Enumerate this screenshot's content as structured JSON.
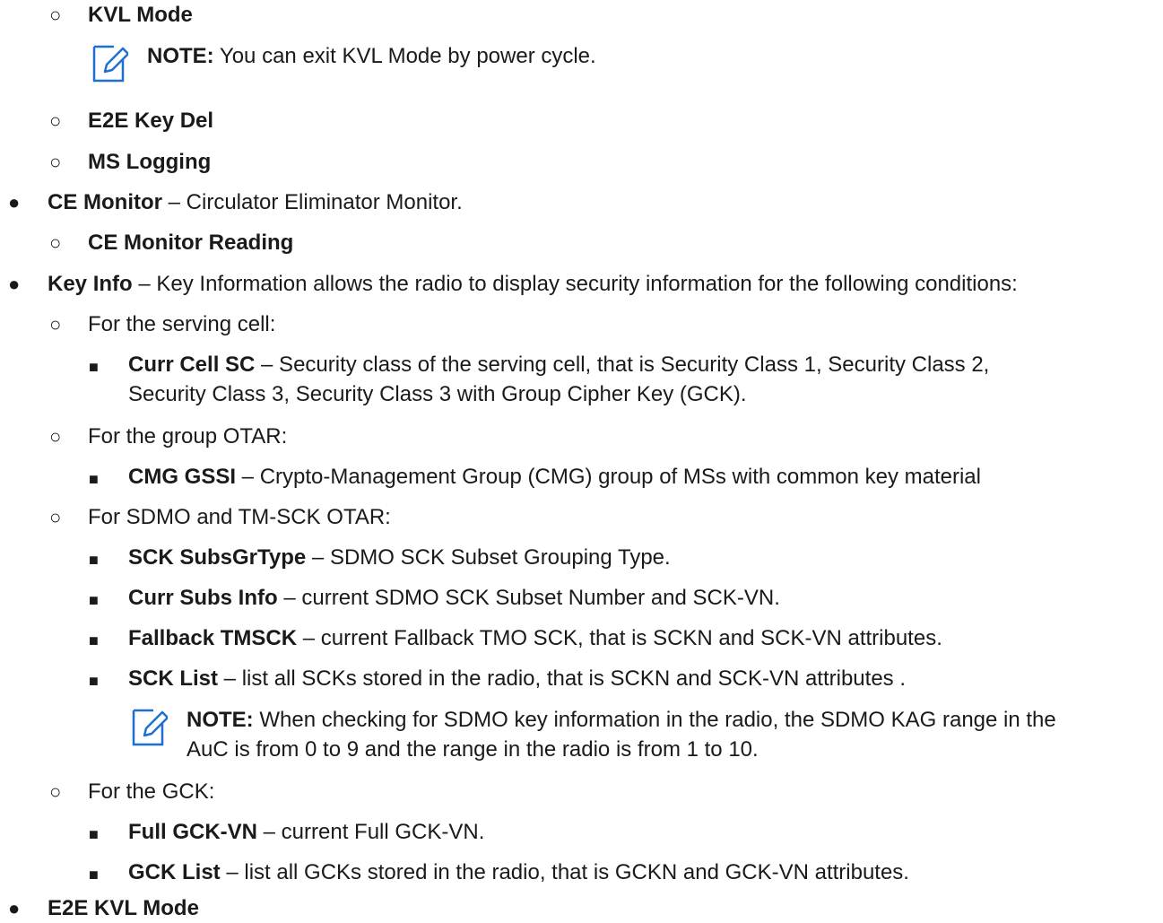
{
  "items": [
    {
      "level": 2,
      "bold": "KVL Mode",
      "text": ""
    },
    {
      "note": true,
      "label": "NOTE:",
      "text": " You can exit KVL Mode by power cycle."
    },
    {
      "level": 2,
      "bold": "E2E Key Del",
      "text": ""
    },
    {
      "level": 2,
      "bold": "MS Logging",
      "text": ""
    },
    {
      "level": 1,
      "bold": "CE Monitor",
      "text": " – Circulator Eliminator Monitor."
    },
    {
      "level": 2,
      "bold": "CE Monitor Reading",
      "text": ""
    },
    {
      "level": 1,
      "bold": "Key Info",
      "text": " – Key Information allows the radio to display security information for the following conditions:"
    },
    {
      "level": 2,
      "bold": "",
      "text": "For the serving cell:"
    },
    {
      "level": 3,
      "bold": "Curr Cell SC",
      "text": " – Security class of the serving cell, that is Security Class 1, Security Class 2,",
      "cont": "Security Class 3, Security Class 3 with Group Cipher Key (GCK)."
    },
    {
      "level": 2,
      "bold": "",
      "text": "For the group OTAR:"
    },
    {
      "level": 3,
      "bold": "CMG GSSI",
      "text": " – Crypto-Management Group (CMG) group of MSs with common key material"
    },
    {
      "level": 2,
      "bold": "",
      "text": "For SDMO and TM-SCK OTAR:"
    },
    {
      "level": 3,
      "bold": "SCK SubsGrType",
      "text": " – SDMO SCK Subset Grouping Type."
    },
    {
      "level": 3,
      "bold": "Curr Subs Info",
      "text": " – current SDMO SCK Subset Number and SCK-VN."
    },
    {
      "level": 3,
      "bold": "Fallback TMSCK",
      "text": " – current Fallback TMO SCK, that is SCKN and SCK-VN attributes."
    },
    {
      "level": 3,
      "bold": "SCK List",
      "text": " – list all SCKs stored in the radio, that is SCKN and SCK-VN attributes ."
    },
    {
      "note": true,
      "label": "NOTE:",
      "text": " When checking for SDMO key information in the radio, the SDMO KAG range in the",
      "cont": "AuC is from 0 to 9 and the range in the radio is from 1 to 10."
    },
    {
      "level": 2,
      "bold": "",
      "text": "For the GCK:"
    },
    {
      "level": 3,
      "bold": "Full GCK-VN",
      "text": " – current Full GCK-VN."
    },
    {
      "level": 3,
      "bold": "GCK List",
      "text": " – list all GCKs stored in the radio, that is GCKN and GCK-VN attributes."
    },
    {
      "level": 1,
      "bold": "E2E KVL Mode",
      "text": ""
    }
  ],
  "bullets": {
    "level1": "●",
    "level2": "○",
    "level3": "■"
  },
  "colors": {
    "note_icon": "#1f6fd1",
    "text": "#1a1a1a"
  }
}
